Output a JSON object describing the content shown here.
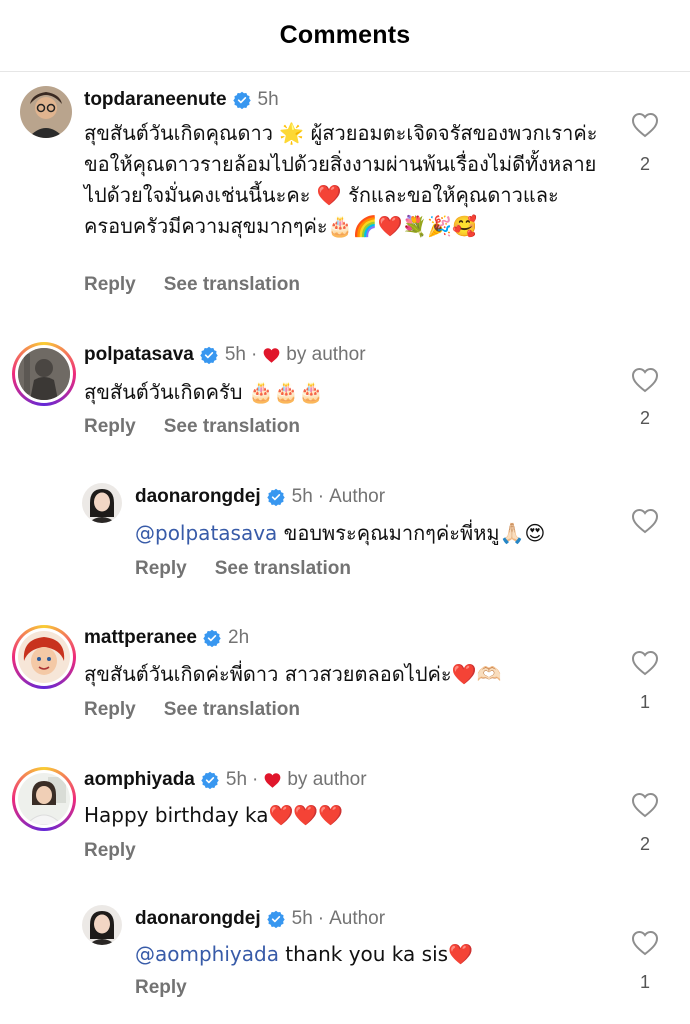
{
  "header": {
    "title": "Comments"
  },
  "comments": [
    {
      "username": "topdaraneenute",
      "time": "5h",
      "text": "สุขสันต์วันเกิดคุณดาว 🌟 ผู้สวยอมตะเจิดจรัสของพวกเราค่ะ ขอให้คุณดาวรายล้อมไปด้วยสิ่งงามผ่านพ้นเรื่องไม่ดีทั้งหลายไปด้วยใจมั่นคงเช่นนี้นะคะ ❤️ รักและขอให้คุณดาวและครอบครัวมีความสุขมากๆค่ะ🎂🌈❤️💐🎉🥰",
      "reply_label": "Reply",
      "translate_label": "See translation",
      "likes": "2"
    },
    {
      "username": "polpatasava",
      "time": "5h",
      "by_author": "by author",
      "text": "สุขสันต์วันเกิดครับ 🎂🎂🎂",
      "reply_label": "Reply",
      "translate_label": "See translation",
      "likes": "2"
    },
    {
      "username": "daonarongdej",
      "time": "5h",
      "author_tag": "Author",
      "mention": "@polpatasava",
      "text": " ขอบพระคุณมากๆค่ะพี่หมู🙏🏻😍",
      "reply_label": "Reply",
      "translate_label": "See translation",
      "likes": ""
    },
    {
      "username": "mattperanee",
      "time": "2h",
      "text": "สุขสันต์วันเกิดค่ะพี่ดาว สาวสวยตลอดไปค่ะ❤️🫶🏻",
      "reply_label": "Reply",
      "translate_label": "See translation",
      "likes": "1"
    },
    {
      "username": "aomphiyada",
      "time": "5h",
      "by_author": "by author",
      "text": "Happy birthday ka❤️❤️❤️",
      "reply_label": "Reply",
      "likes": "2"
    },
    {
      "username": "daonarongdej",
      "time": "5h",
      "author_tag": "Author",
      "mention": "@aomphiyada",
      "text": " thank you ka sis❤️",
      "reply_label": "Reply",
      "likes": "1"
    }
  ],
  "colors": {
    "verified": "#3897f0",
    "heart": "#ed4956",
    "mention": "#385ba8",
    "muted": "#737373"
  }
}
